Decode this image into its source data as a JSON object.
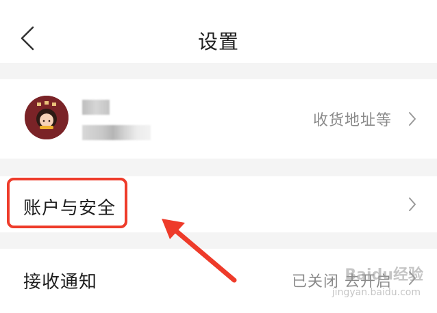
{
  "nav": {
    "title": "设置"
  },
  "profile": {
    "right_text": "收货地址等"
  },
  "rows": [
    {
      "label": "账户与安全",
      "value": ""
    },
    {
      "label": "接收通知",
      "value": "已关闭 去开启"
    }
  ],
  "watermark": {
    "brand": "Baidu经验",
    "url": "jingyan.baidu.com"
  },
  "colors": {
    "highlight": "#ee3b2a",
    "arrow": "#ee3b2a",
    "background": "#f4f4f4"
  }
}
